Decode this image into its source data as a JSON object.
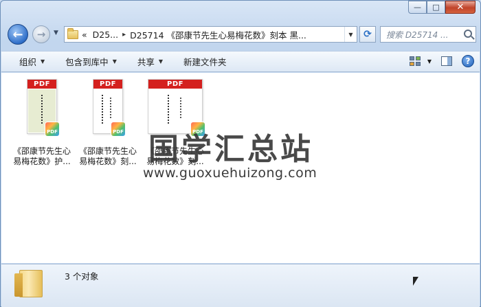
{
  "window": {
    "controls": {
      "minimize": "—",
      "maximize": "□",
      "close": "✕"
    }
  },
  "nav": {
    "back_icon": "←",
    "forward_icon": "→",
    "history_drop": "▼",
    "breadcrumb": {
      "overflow": "«",
      "segment1": "D25...",
      "separator": "▸",
      "segment2": "D25714 《邵康节先生心易梅花数》刻本 黑..."
    },
    "address_drop": "▼",
    "refresh_icon": "⟳",
    "search_placeholder": "搜索 D25714 ..."
  },
  "toolbar": {
    "items": [
      {
        "label": "组织",
        "caret": "▼"
      },
      {
        "label": "包含到库中",
        "caret": "▼"
      },
      {
        "label": "共享",
        "caret": "▼"
      },
      {
        "label": "新建文件夹",
        "caret": ""
      }
    ],
    "views_caret": "▼",
    "help_label": "?"
  },
  "files": [
    {
      "band": "PDF",
      "badge": "PDF",
      "label": "《邵康节先生心易梅花数》护..."
    },
    {
      "band": "PDF",
      "badge": "PDF",
      "label": "《邵康节先生心易梅花数》刻..."
    },
    {
      "band": "PDF",
      "badge": "PDF",
      "label": "《邵康节先生心易梅花数》刻..."
    }
  ],
  "watermark": {
    "title": "国学汇总站",
    "url": "www.guoxuehuizong.com"
  },
  "status": {
    "count_text": "3 个对象"
  },
  "colors": {
    "pdf_red": "#d4201e",
    "frame_blue": "#c2d6ee",
    "close_red": "#c0432a"
  }
}
